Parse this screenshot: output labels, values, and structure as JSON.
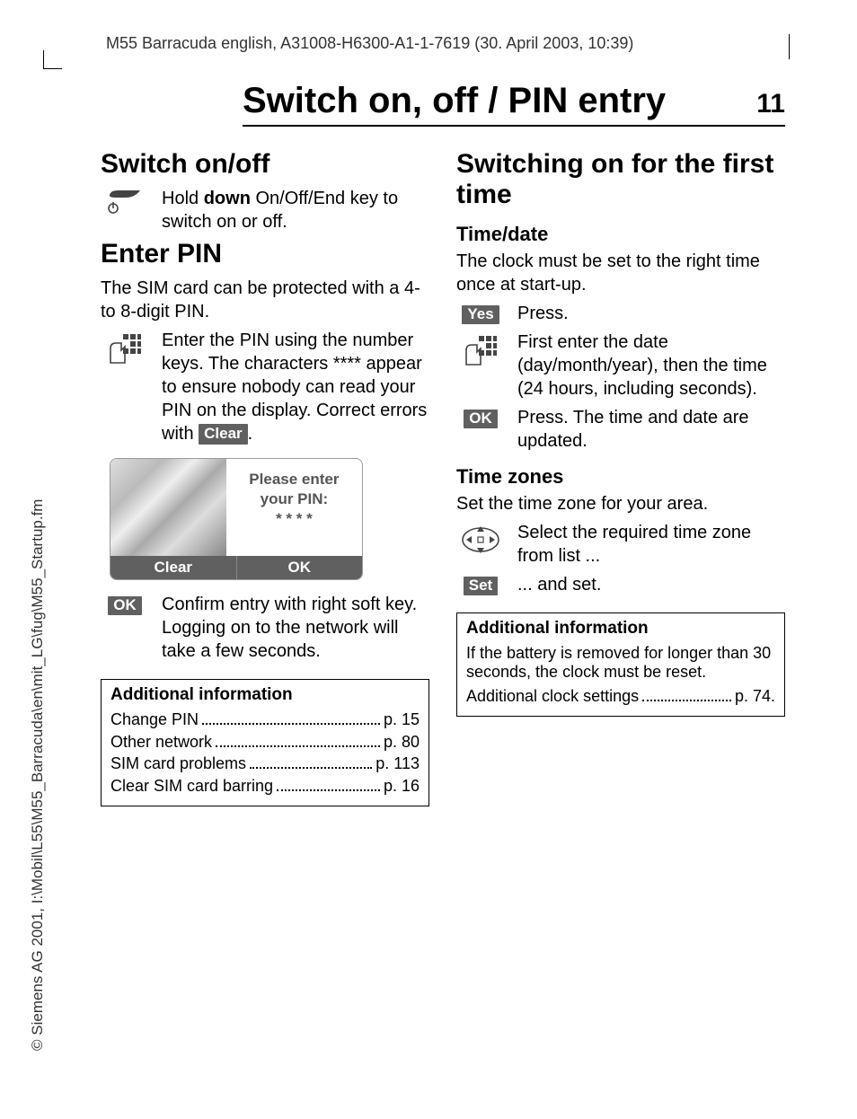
{
  "header": "M55 Barracuda english, A31008-H6300-A1-1-7619 (30. April 2003, 10:39)",
  "sideways": "© Siemens AG 2001, I:\\Mobil\\L55\\M55_Barracuda\\en\\mit_LG\\fug\\M55_Startup.fm",
  "title": "Switch on, off / PIN entry",
  "pagenum": "11",
  "left": {
    "h_switch": "Switch on/off",
    "switch_text_pre": "Hold ",
    "switch_text_bold": "down",
    "switch_text_post": " On/Off/End key to switch on or off.",
    "h_pin": "Enter PIN",
    "pin_intro": "The SIM card can be protected with a 4- to 8-digit PIN.",
    "pin_enter": "Enter the PIN using the number keys. The characters **** appear to ensure nobody can read your PIN on the display. Correct errors with ",
    "clear_label": "Clear",
    "period": ".",
    "phone_prompt1": "Please enter",
    "phone_prompt2": "your PIN:",
    "phone_stars": "* * * *",
    "phone_left": "Clear",
    "phone_right": "OK",
    "ok_label": "OK",
    "ok_text": "Confirm entry with right soft key. Logging on to the network will take a few seconds.",
    "info_title": "Additional information",
    "info_rows": [
      {
        "l": "Change PIN",
        "r": "p. 15"
      },
      {
        "l": "Other network",
        "r": "p. 80"
      },
      {
        "l": "SIM card problems",
        "r": "p. 113"
      },
      {
        "l": "Clear SIM card barring",
        "r": "p. 16"
      }
    ]
  },
  "right": {
    "h_first": "Switching on for the first time",
    "h_timedate": "Time/date",
    "timedate_text": "The clock must be set to the right time once at start-up.",
    "yes_label": "Yes",
    "yes_text": "Press.",
    "keypad_text": "First enter the date (day/month/year), then the time (24 hours, including seconds).",
    "ok_label": "OK",
    "ok_text": "Press. The time and date are updated.",
    "h_zones": "Time zones",
    "zones_text": "Set the time zone for your area.",
    "nav_text": "Select the required time zone from list ...",
    "set_label": "Set",
    "set_text": "... and set.",
    "info_title": "Additional information",
    "info_body": "If the battery is removed for longer than 30 seconds, the clock must be reset.",
    "info_row_l": "Additional clock settings",
    "info_row_r": "p. 74."
  }
}
